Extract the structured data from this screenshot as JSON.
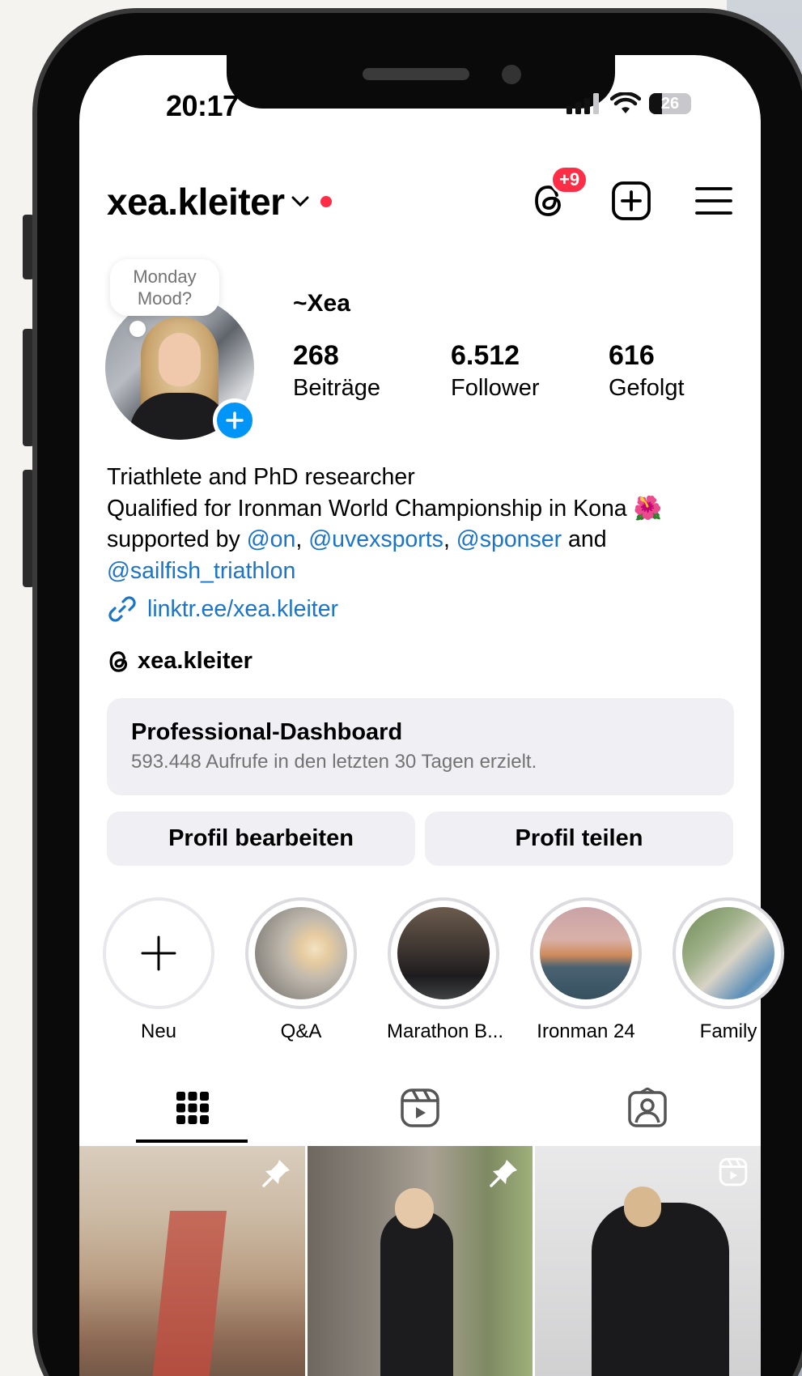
{
  "status_bar": {
    "time": "20:17",
    "battery": "26"
  },
  "header": {
    "username": "xea.kleiter",
    "threads_badge": "+9"
  },
  "profile": {
    "note": "Monday Mood?",
    "display_name": "~Xea",
    "stats": [
      {
        "value": "268",
        "label": "Beiträge"
      },
      {
        "value": "6.512",
        "label": "Follower"
      },
      {
        "value": "616",
        "label": "Gefolgt"
      }
    ],
    "bio": {
      "line1": "Triathlete and PhD researcher",
      "line2": "Qualified for Ironman World Championship in Kona",
      "line2_emoji": "🌺",
      "line3_prefix": "supported by ",
      "mention1": "@on",
      "sep1": ", ",
      "mention2": "@uvexsports",
      "sep2": ", ",
      "mention3": "@sponser",
      "line3_suffix": " and",
      "mention4": "@sailfish_triathlon"
    },
    "link": "linktr.ee/xea.kleiter",
    "threads_handle": "xea.kleiter"
  },
  "dashboard": {
    "title": "Professional-Dashboard",
    "subtitle": "593.448 Aufrufe in den letzten 30 Tagen erzielt."
  },
  "buttons": {
    "edit": "Profil bearbeiten",
    "share": "Profil teilen"
  },
  "highlights": [
    {
      "label": "Neu"
    },
    {
      "label": "Q&A"
    },
    {
      "label": "Marathon B..."
    },
    {
      "label": "Ironman 24"
    },
    {
      "label": "Family"
    }
  ],
  "tabs": [
    "grid-icon",
    "reels-icon",
    "tagged-icon"
  ],
  "colors": {
    "accent_blue": "#0095f6",
    "link_blue": "#1c74c9",
    "badge_red": "#ff2d46",
    "button_gray": "#efeff4"
  }
}
